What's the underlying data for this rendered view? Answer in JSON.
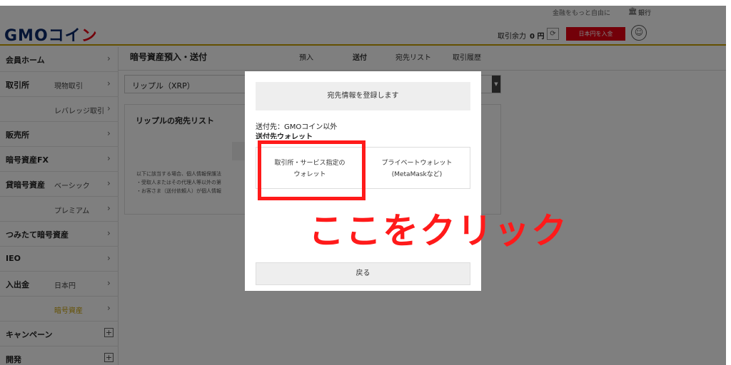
{
  "header": {
    "logo_main": "GMOコイ",
    "logo_accent": "ン",
    "top_link": "金融をもっと自由に",
    "bank_icon": "bank-icon",
    "bank_label": "銀行",
    "balance_label": "取引余力",
    "balance_value": "0 円",
    "refresh_glyph": "⟳",
    "deposit_button": "日本円を入金",
    "user_glyph": "☺"
  },
  "sidebar": {
    "items": [
      {
        "main": "会員ホーム",
        "sub": "",
        "control": "›"
      },
      {
        "main": "取引所",
        "sub": "現物取引",
        "control": "›"
      },
      {
        "main": "",
        "sub": "レバレッジ取引",
        "control": "›"
      },
      {
        "main": "販売所",
        "sub": "",
        "control": "›"
      },
      {
        "main": "暗号資産FX",
        "sub": "",
        "control": "›"
      },
      {
        "main": "貸暗号資産",
        "sub": "ベーシック",
        "control": "›"
      },
      {
        "main": "",
        "sub": "プレミアム",
        "control": "›"
      },
      {
        "main": "つみたて暗号資産",
        "sub": "",
        "control": "›"
      },
      {
        "main": "IEO",
        "sub": "",
        "control": "›"
      },
      {
        "main": "入出金",
        "sub": "日本円",
        "control": "›"
      },
      {
        "main": "",
        "sub": "暗号資産",
        "control": "›"
      },
      {
        "main": "キャンペーン",
        "sub": "",
        "control": "+"
      },
      {
        "main": "開発",
        "sub": "",
        "control": "+"
      }
    ]
  },
  "main": {
    "title": "暗号資産預入・送付",
    "tabs": [
      {
        "label": "預入"
      },
      {
        "label": "送付"
      },
      {
        "label": "宛先リスト"
      },
      {
        "label": "取引履歴"
      }
    ],
    "currency_select": "リップル（XRP）",
    "select_arrow": "▼",
    "list_title": "リップルの宛先リスト",
    "notices": [
      "以下に該当する場合、個人情報保護法",
      "・受取人またはその代理人等以外の第",
      "・お客さま（送付依頼人）が個人情報"
    ],
    "panel_mark": ")"
  },
  "modal": {
    "header": "宛先情報を登録します",
    "destination": "送付先：GMOコイン以外",
    "wallet_heading": "送付先ウォレット",
    "option_exchange": [
      "取引所・サービス指定の",
      "ウォレット"
    ],
    "option_private": [
      "プライベートウォレット",
      "(MetaMaskなど)"
    ],
    "back_button": "戻る"
  },
  "annotation": {
    "callout": "ここをクリック",
    "color": "#ff1a1a"
  },
  "colors": {
    "brand_navy": "#0c2a6b",
    "brand_red": "#e60012",
    "gold": "#c8a000"
  }
}
